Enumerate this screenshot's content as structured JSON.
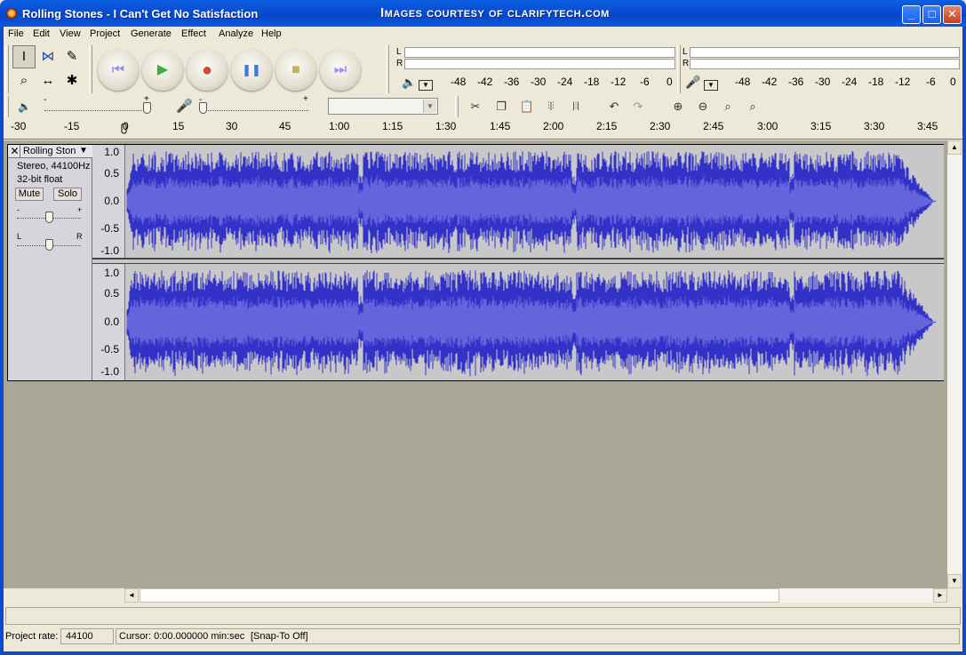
{
  "window": {
    "title": "Rolling Stones - I Can't Get No Satisfaction",
    "watermark": "Images courtesy of clarifytech.com",
    "minimize": "_",
    "maximize": "□",
    "close": "✕"
  },
  "menu": [
    "File",
    "Edit",
    "View",
    "Project",
    "Generate",
    "Effect",
    "Analyze",
    "Help"
  ],
  "tools": {
    "selection": "I",
    "envelope": "⋈",
    "draw": "✎",
    "zoom": "⌕",
    "timeshift": "↔",
    "multi": "✱"
  },
  "transport": {
    "skip_start": "⏮",
    "play": "▶",
    "record": "●",
    "pause": "❚❚",
    "stop": "■",
    "skip_end": "⏭",
    "colors": {
      "skip": "#9a8cf0",
      "play": "#3cae3c",
      "record": "#d04a3c",
      "pause": "#3c7ae8",
      "stop": "#c8b060"
    }
  },
  "meters": {
    "left_label": "L",
    "right_label": "R",
    "scale": [
      "-48",
      "-42",
      "-36",
      "-30",
      "-24",
      "-18",
      "-12",
      "-6",
      "0"
    ]
  },
  "mixer": {
    "volume_min": "-",
    "volume_max": "+",
    "input_device": ""
  },
  "ruler": [
    "-30",
    "-15",
    "0",
    "15",
    "30",
    "45",
    "1:00",
    "1:15",
    "1:30",
    "1:45",
    "2:00",
    "2:15",
    "2:30",
    "2:45",
    "3:00",
    "3:15",
    "3:30",
    "3:45"
  ],
  "track": {
    "close": "✕",
    "name": "Rolling Ston",
    "menu_arrow": "▼",
    "format": "Stereo, 44100Hz",
    "bitdepth": "32-bit float",
    "mute": "Mute",
    "solo": "Solo",
    "gain_min": "-",
    "gain_max": "+",
    "pan_left": "L",
    "pan_right": "R",
    "scale": [
      "1.0",
      "0.5",
      "0.0",
      "-0.5",
      "-1.0"
    ],
    "waveform_color": "#3232c8",
    "waveform_rms_color": "#6464dc"
  },
  "status": {
    "project_rate_label": "Project rate:",
    "project_rate": "44100",
    "cursor": "Cursor: 0:00.000000 min:sec",
    "snap": "[Snap-To Off]"
  },
  "scroll": {
    "up": "▲",
    "down": "▼",
    "left": "◄",
    "right": "►"
  }
}
